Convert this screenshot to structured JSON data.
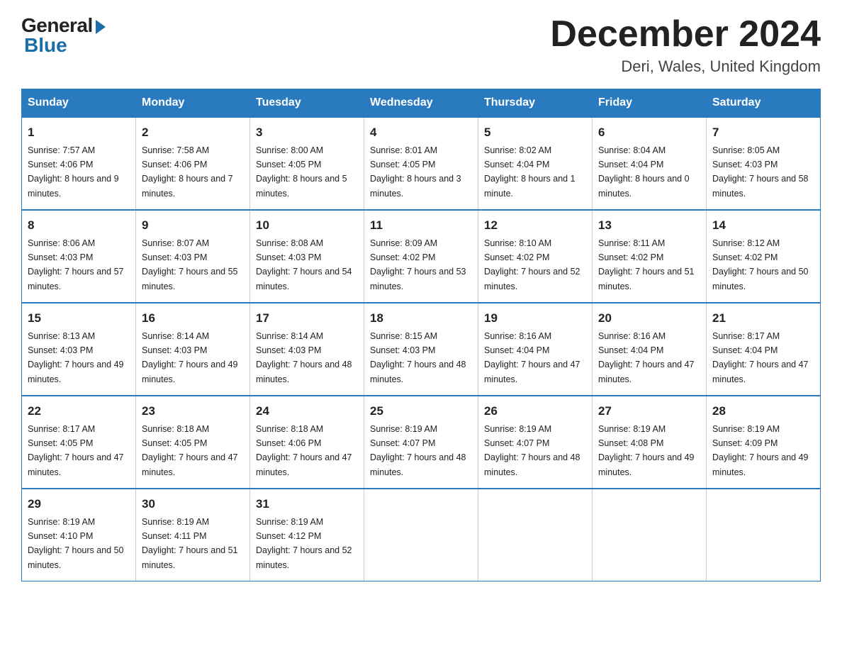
{
  "logo": {
    "general": "General",
    "blue": "Blue"
  },
  "title": "December 2024",
  "location": "Deri, Wales, United Kingdom",
  "headers": [
    "Sunday",
    "Monday",
    "Tuesday",
    "Wednesday",
    "Thursday",
    "Friday",
    "Saturday"
  ],
  "weeks": [
    [
      {
        "day": "1",
        "sunrise": "Sunrise: 7:57 AM",
        "sunset": "Sunset: 4:06 PM",
        "daylight": "Daylight: 8 hours and 9 minutes."
      },
      {
        "day": "2",
        "sunrise": "Sunrise: 7:58 AM",
        "sunset": "Sunset: 4:06 PM",
        "daylight": "Daylight: 8 hours and 7 minutes."
      },
      {
        "day": "3",
        "sunrise": "Sunrise: 8:00 AM",
        "sunset": "Sunset: 4:05 PM",
        "daylight": "Daylight: 8 hours and 5 minutes."
      },
      {
        "day": "4",
        "sunrise": "Sunrise: 8:01 AM",
        "sunset": "Sunset: 4:05 PM",
        "daylight": "Daylight: 8 hours and 3 minutes."
      },
      {
        "day": "5",
        "sunrise": "Sunrise: 8:02 AM",
        "sunset": "Sunset: 4:04 PM",
        "daylight": "Daylight: 8 hours and 1 minute."
      },
      {
        "day": "6",
        "sunrise": "Sunrise: 8:04 AM",
        "sunset": "Sunset: 4:04 PM",
        "daylight": "Daylight: 8 hours and 0 minutes."
      },
      {
        "day": "7",
        "sunrise": "Sunrise: 8:05 AM",
        "sunset": "Sunset: 4:03 PM",
        "daylight": "Daylight: 7 hours and 58 minutes."
      }
    ],
    [
      {
        "day": "8",
        "sunrise": "Sunrise: 8:06 AM",
        "sunset": "Sunset: 4:03 PM",
        "daylight": "Daylight: 7 hours and 57 minutes."
      },
      {
        "day": "9",
        "sunrise": "Sunrise: 8:07 AM",
        "sunset": "Sunset: 4:03 PM",
        "daylight": "Daylight: 7 hours and 55 minutes."
      },
      {
        "day": "10",
        "sunrise": "Sunrise: 8:08 AM",
        "sunset": "Sunset: 4:03 PM",
        "daylight": "Daylight: 7 hours and 54 minutes."
      },
      {
        "day": "11",
        "sunrise": "Sunrise: 8:09 AM",
        "sunset": "Sunset: 4:02 PM",
        "daylight": "Daylight: 7 hours and 53 minutes."
      },
      {
        "day": "12",
        "sunrise": "Sunrise: 8:10 AM",
        "sunset": "Sunset: 4:02 PM",
        "daylight": "Daylight: 7 hours and 52 minutes."
      },
      {
        "day": "13",
        "sunrise": "Sunrise: 8:11 AM",
        "sunset": "Sunset: 4:02 PM",
        "daylight": "Daylight: 7 hours and 51 minutes."
      },
      {
        "day": "14",
        "sunrise": "Sunrise: 8:12 AM",
        "sunset": "Sunset: 4:02 PM",
        "daylight": "Daylight: 7 hours and 50 minutes."
      }
    ],
    [
      {
        "day": "15",
        "sunrise": "Sunrise: 8:13 AM",
        "sunset": "Sunset: 4:03 PM",
        "daylight": "Daylight: 7 hours and 49 minutes."
      },
      {
        "day": "16",
        "sunrise": "Sunrise: 8:14 AM",
        "sunset": "Sunset: 4:03 PM",
        "daylight": "Daylight: 7 hours and 49 minutes."
      },
      {
        "day": "17",
        "sunrise": "Sunrise: 8:14 AM",
        "sunset": "Sunset: 4:03 PM",
        "daylight": "Daylight: 7 hours and 48 minutes."
      },
      {
        "day": "18",
        "sunrise": "Sunrise: 8:15 AM",
        "sunset": "Sunset: 4:03 PM",
        "daylight": "Daylight: 7 hours and 48 minutes."
      },
      {
        "day": "19",
        "sunrise": "Sunrise: 8:16 AM",
        "sunset": "Sunset: 4:04 PM",
        "daylight": "Daylight: 7 hours and 47 minutes."
      },
      {
        "day": "20",
        "sunrise": "Sunrise: 8:16 AM",
        "sunset": "Sunset: 4:04 PM",
        "daylight": "Daylight: 7 hours and 47 minutes."
      },
      {
        "day": "21",
        "sunrise": "Sunrise: 8:17 AM",
        "sunset": "Sunset: 4:04 PM",
        "daylight": "Daylight: 7 hours and 47 minutes."
      }
    ],
    [
      {
        "day": "22",
        "sunrise": "Sunrise: 8:17 AM",
        "sunset": "Sunset: 4:05 PM",
        "daylight": "Daylight: 7 hours and 47 minutes."
      },
      {
        "day": "23",
        "sunrise": "Sunrise: 8:18 AM",
        "sunset": "Sunset: 4:05 PM",
        "daylight": "Daylight: 7 hours and 47 minutes."
      },
      {
        "day": "24",
        "sunrise": "Sunrise: 8:18 AM",
        "sunset": "Sunset: 4:06 PM",
        "daylight": "Daylight: 7 hours and 47 minutes."
      },
      {
        "day": "25",
        "sunrise": "Sunrise: 8:19 AM",
        "sunset": "Sunset: 4:07 PM",
        "daylight": "Daylight: 7 hours and 48 minutes."
      },
      {
        "day": "26",
        "sunrise": "Sunrise: 8:19 AM",
        "sunset": "Sunset: 4:07 PM",
        "daylight": "Daylight: 7 hours and 48 minutes."
      },
      {
        "day": "27",
        "sunrise": "Sunrise: 8:19 AM",
        "sunset": "Sunset: 4:08 PM",
        "daylight": "Daylight: 7 hours and 49 minutes."
      },
      {
        "day": "28",
        "sunrise": "Sunrise: 8:19 AM",
        "sunset": "Sunset: 4:09 PM",
        "daylight": "Daylight: 7 hours and 49 minutes."
      }
    ],
    [
      {
        "day": "29",
        "sunrise": "Sunrise: 8:19 AM",
        "sunset": "Sunset: 4:10 PM",
        "daylight": "Daylight: 7 hours and 50 minutes."
      },
      {
        "day": "30",
        "sunrise": "Sunrise: 8:19 AM",
        "sunset": "Sunset: 4:11 PM",
        "daylight": "Daylight: 7 hours and 51 minutes."
      },
      {
        "day": "31",
        "sunrise": "Sunrise: 8:19 AM",
        "sunset": "Sunset: 4:12 PM",
        "daylight": "Daylight: 7 hours and 52 minutes."
      },
      null,
      null,
      null,
      null
    ]
  ]
}
